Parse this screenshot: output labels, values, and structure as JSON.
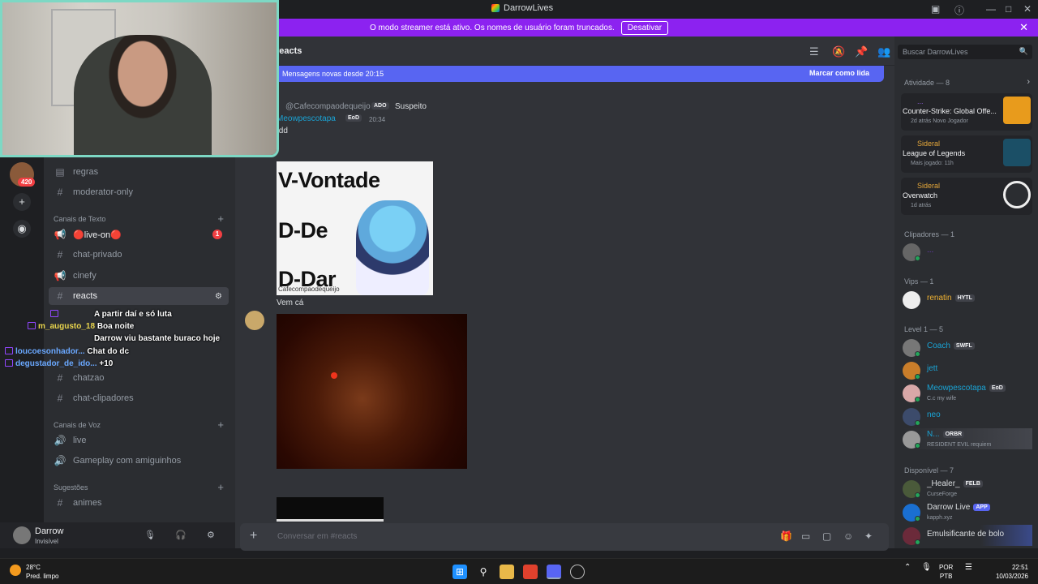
{
  "window": {
    "title": "DarrowLives",
    "controls": [
      "—",
      "□",
      "✕"
    ]
  },
  "banner": {
    "text": "O modo streamer está ativo. Os nomes de usuário foram truncados.",
    "button": "Desativar"
  },
  "servers": {
    "badge": "420"
  },
  "channels": [
    {
      "id": "regras",
      "label": "regras",
      "icon": "rules-icon"
    },
    {
      "id": "moderator-only",
      "label": "moderator-only",
      "icon": "hash-icon"
    },
    {
      "id": "live-on",
      "label": "🔴live-on🔴",
      "icon": "announcement-icon",
      "badge": "1"
    },
    {
      "id": "chat-privado",
      "label": "chat-privado",
      "icon": "hash-icon"
    },
    {
      "id": "cinefy",
      "label": "cinefy",
      "icon": "announcement-icon"
    },
    {
      "id": "reacts",
      "label": "reacts",
      "icon": "hash-icon"
    },
    {
      "id": "chatzao",
      "label": "chatzao",
      "icon": "hash-icon"
    },
    {
      "id": "chat-clipadores",
      "label": "chat-clipadores",
      "icon": "hash-icon"
    },
    {
      "id": "live",
      "label": "live",
      "icon": "voice-icon"
    },
    {
      "id": "gameplay",
      "label": "Gameplay com amiguinhos",
      "icon": "voice-icon"
    },
    {
      "id": "animes",
      "label": "animes",
      "icon": "hash-icon"
    }
  ],
  "categories": {
    "text": "Canais de Texto",
    "voice": "Canais de Voz",
    "suggestions": "Sugestões"
  },
  "chat_overlay": [
    {
      "user": "",
      "text": "A partir daí e só luta"
    },
    {
      "user": "m_augusto_18",
      "text": "Boa noite"
    },
    {
      "user": "",
      "text": "Darrow viu bastante buraco hoje"
    },
    {
      "user": "loucoesonhador...",
      "text": "Chat do dc"
    },
    {
      "user": "degustador_de_ido...",
      "text": "+10"
    }
  ],
  "user_panel": {
    "name": "Darrow",
    "status": "Invisível"
  },
  "main": {
    "channel": "reacts",
    "new_messages": "Mensagens novas desde 20:15",
    "mark_read": "Marcar como lida",
    "reply_author": "@Cafecompaodequeijo",
    "reply_tag": "ADO",
    "reply_text": "Suspeito",
    "author": "Meowpescotapa",
    "author_tag": "EoD",
    "time": "20:34",
    "msg1": "/dd",
    "meme_lines": [
      "V-Vontade",
      "D-De",
      "D-Dar"
    ],
    "meme_caption": "Cafecompaodequeijo",
    "msg2": "Vem cá",
    "composer_placeholder": "Conversar em #reacts"
  },
  "members": {
    "search_placeholder": "Buscar DarrowLives",
    "activity_header": "Atividade — 8",
    "activities": [
      {
        "who": "...",
        "game": "Counter-Strike: Global Offe...",
        "meta": "2d atrás  Novo Jogador",
        "color": "#e89b1c"
      },
      {
        "who": "Sideral",
        "game": "League of Legends",
        "meta": "Mais jogado: 11h",
        "color": "#2a8fb5"
      },
      {
        "who": "Sideral",
        "game": "Overwatch",
        "meta": "1d atrás",
        "color": "#ffffff"
      }
    ],
    "groups": [
      {
        "header": "Clipadores — 1",
        "items": [
          {
            "name": "...",
            "color": "#6e3bbf",
            "sub": ""
          }
        ]
      },
      {
        "header": "Vips — 1",
        "items": [
          {
            "name": "renatin",
            "tag": "HYTL",
            "color": "#f0b232",
            "sub": ""
          }
        ]
      },
      {
        "header": "Level 1 — 5",
        "items": [
          {
            "name": "Coach",
            "tag": "SWFL",
            "color": "#1aa3d4",
            "sub": ""
          },
          {
            "name": "jett",
            "tag": "",
            "color": "#1aa3d4",
            "sub": ""
          },
          {
            "name": "Meowpescotapa",
            "tag": "EoD",
            "color": "#1aa3d4",
            "sub": "C.c my wife"
          },
          {
            "name": "neo",
            "tag": "",
            "color": "#1aa3d4",
            "sub": ""
          },
          {
            "name": "N...",
            "tag": "ORBR",
            "color": "#1aa3d4",
            "sub": "RESIDENT EVIL requiem"
          }
        ]
      },
      {
        "header": "Disponível — 7",
        "items": [
          {
            "name": "_Healer_",
            "tag": "FELB",
            "color": "#dbdee1",
            "sub": "CurseForge"
          },
          {
            "name": "Darrow Live",
            "tag": "APP",
            "color": "#dbdee1",
            "sub": "kapph.xyz"
          },
          {
            "name": "Emulsificante de bolo",
            "tag": "",
            "color": "#dbdee1",
            "sub": ""
          }
        ]
      }
    ]
  },
  "taskbar": {
    "temp": "28°C",
    "weather": "Pred. limpo",
    "lang1": "POR",
    "lang2": "PTB",
    "time": "22:51",
    "date": "10/03/2026"
  },
  "colors": {
    "accent": "#5865f2",
    "banner": "#8c22f0",
    "webcam_border": "#7dd8c4"
  }
}
